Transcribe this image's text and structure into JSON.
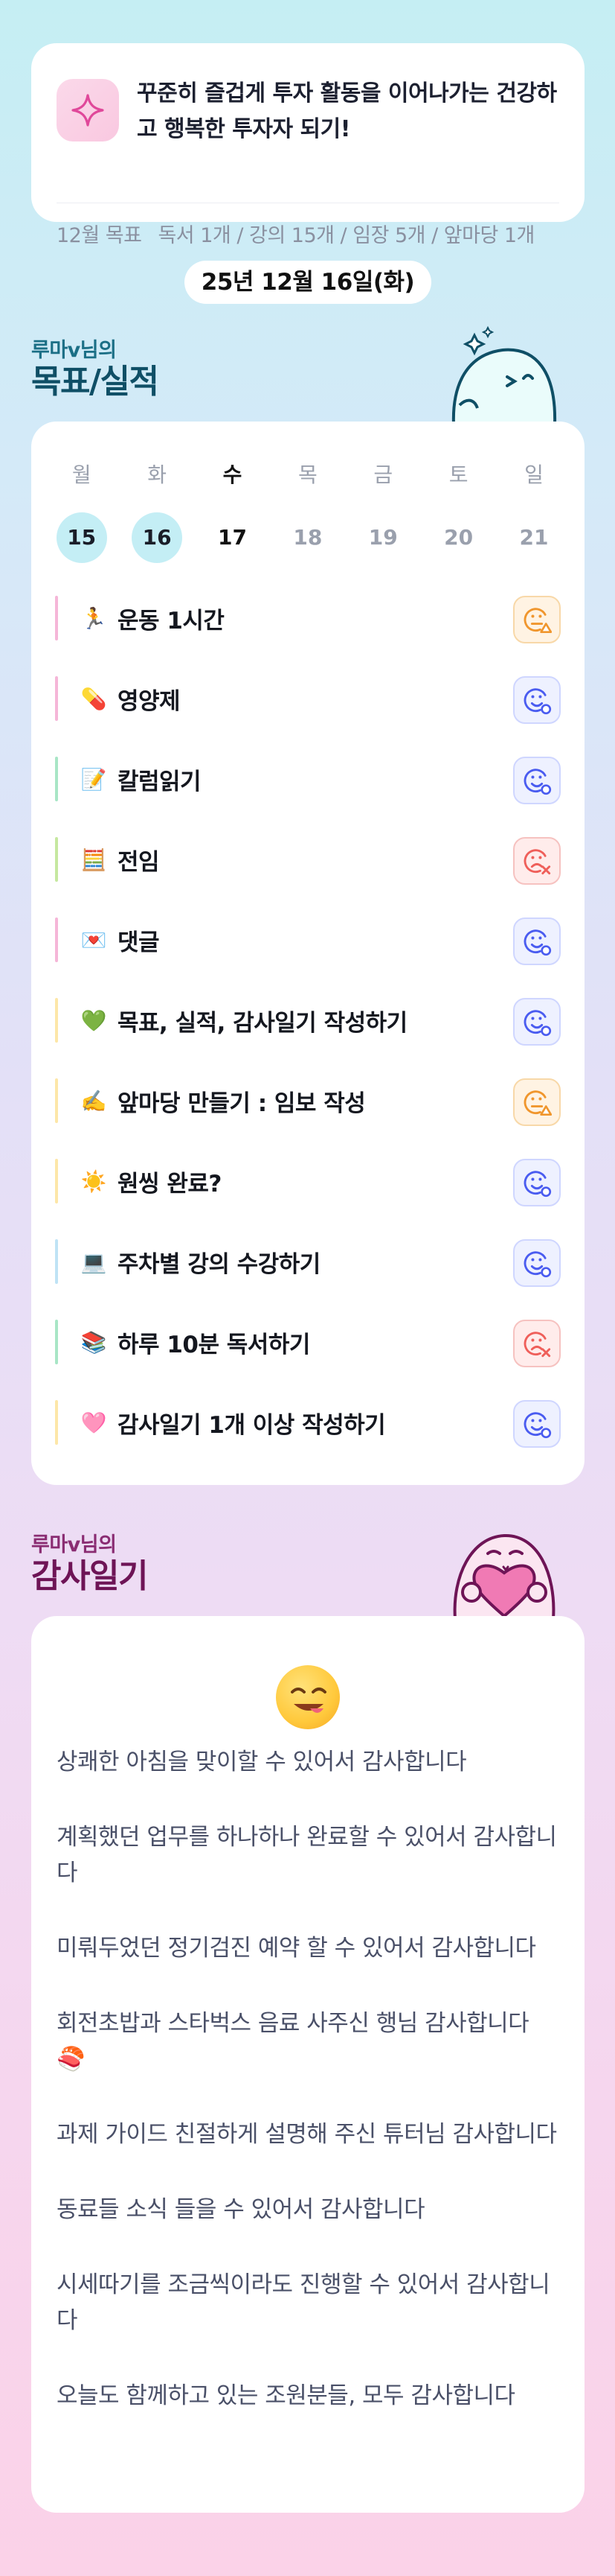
{
  "goal": {
    "text": "꾸준히 즐겁게 투자 활동을 이어나가는 건강하고 행복한 투자자 되기!",
    "month_label": "12월 목표",
    "month_detail": "독서 1개 / 강의 15개 / 임장 5개 / 앞마당 1개"
  },
  "date": "25년 12월 16일(화)",
  "goal_section": {
    "small": "루마v님의",
    "big": "목표/실적"
  },
  "week": [
    {
      "name": "월",
      "num": "15",
      "state": "done"
    },
    {
      "name": "화",
      "num": "16",
      "state": "done"
    },
    {
      "name": "수",
      "num": "17",
      "state": "today"
    },
    {
      "name": "목",
      "num": "18",
      "state": "future"
    },
    {
      "name": "금",
      "num": "19",
      "state": "future"
    },
    {
      "name": "토",
      "num": "20",
      "state": "future"
    },
    {
      "name": "일",
      "num": "21",
      "state": "future"
    }
  ],
  "items": [
    {
      "emoji": "🏃",
      "label": "운동 1시간",
      "bar": "#f5b6d8",
      "status": "mid"
    },
    {
      "emoji": "💊",
      "label": "영양제",
      "bar": "#f5b6d8",
      "status": "good"
    },
    {
      "emoji": "📝",
      "label": "칼럼읽기",
      "bar": "#a8e6c6",
      "status": "good"
    },
    {
      "emoji": "🧮",
      "label": "전임",
      "bar": "#c6e8a0",
      "status": "bad"
    },
    {
      "emoji": "💌",
      "label": "댓글",
      "bar": "#f5b6d8",
      "status": "good"
    },
    {
      "emoji": "💚",
      "label": "목표, 실적, 감사일기 작성하기",
      "bar": "#fde7a8",
      "status": "good"
    },
    {
      "emoji": "✍️",
      "label": "앞마당 만들기 : 임보 작성",
      "bar": "#fde7a8",
      "status": "mid"
    },
    {
      "emoji": "☀️",
      "label": "원씽 완료?",
      "bar": "#fde7a8",
      "status": "good"
    },
    {
      "emoji": "💻",
      "label": "주차별 강의 수강하기",
      "bar": "#bfe3f5",
      "status": "good"
    },
    {
      "emoji": "📚",
      "label": "하루 10분 독서하기",
      "bar": "#a8e6c6",
      "status": "bad"
    },
    {
      "emoji": "🩷",
      "label": "감사일기 1개 이상 작성하기",
      "bar": "#fde7a8",
      "status": "good"
    }
  ],
  "grat_section": {
    "small": "루마v님의",
    "big": "감사일기"
  },
  "gratitude": [
    "상쾌한 아침을 맞이할 수 있어서 감사합니다",
    "계획했던 업무를 하나하나 완료할 수 있어서 감사합니다",
    "미뤄두었던 정기검진 예약 할 수 있어서 감사합니다",
    "회전초밥과 스타벅스 음료 사주신 행님 감사합니다 🍣",
    "과제 가이드 친절하게 설명해 주신 튜터님 감사합니다",
    "동료들 소식 들을 수 있어서 감사합니다",
    "시세따기를 조금씩이라도 진행할 수 있어서 감사합니다",
    "오늘도 함께하고 있는 조원분들, 모두 감사합니다"
  ],
  "colors": {
    "good": "#4a5cf0",
    "mid": "#f0962d",
    "bad": "#ef5f5a",
    "done_day": "#c4eef5"
  }
}
